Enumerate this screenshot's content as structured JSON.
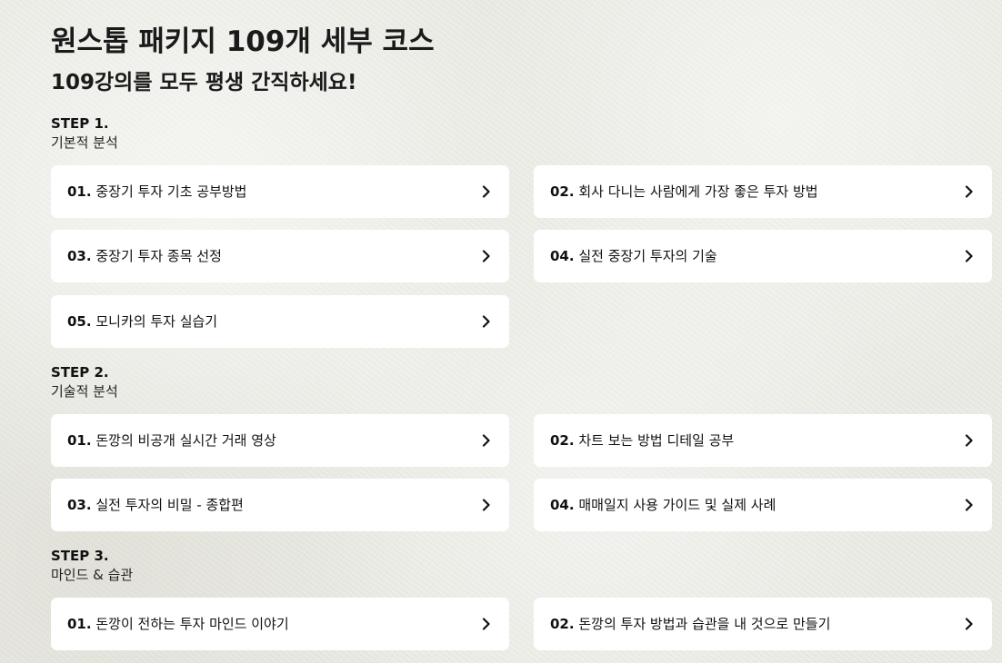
{
  "header": {
    "title": "원스톱 패키지 109개 세부 코스",
    "subtitle": "109강의를 모두 평생 간직하세요!"
  },
  "steps": [
    {
      "label": "STEP 1.",
      "name": "기본적 분석",
      "lessons": [
        {
          "num": "01.",
          "title": "중장기 투자 기초 공부방법"
        },
        {
          "num": "02.",
          "title": "회사 다니는 사람에게 가장 좋은 투자 방법"
        },
        {
          "num": "03.",
          "title": "중장기 투자 종목 선정"
        },
        {
          "num": "04.",
          "title": "실전 중장기 투자의 기술"
        },
        {
          "num": "05.",
          "title": "모니카의 투자 실습기"
        }
      ]
    },
    {
      "label": "STEP 2.",
      "name": "기술적 분석",
      "lessons": [
        {
          "num": "01.",
          "title": "돈깡의 비공개 실시간 거래 영상"
        },
        {
          "num": "02.",
          "title": "차트 보는 방법 디테일 공부"
        },
        {
          "num": "03.",
          "title": "실전 투자의 비밀 - 종합편"
        },
        {
          "num": "04.",
          "title": "매매일지 사용 가이드 및 실제 사례"
        }
      ]
    },
    {
      "label": "STEP 3.",
      "name": "마인드 & 습관",
      "lessons": [
        {
          "num": "01.",
          "title": "돈깡이 전하는 투자 마인드 이야기"
        },
        {
          "num": "02.",
          "title": "돈깡의 투자 방법과 습관을 내 것으로 만들기"
        }
      ]
    }
  ],
  "icons": {
    "card_arrow": "chevron-right-icon"
  },
  "colors": {
    "background": "#ecece6",
    "card": "#ffffff",
    "text": "#111111"
  }
}
